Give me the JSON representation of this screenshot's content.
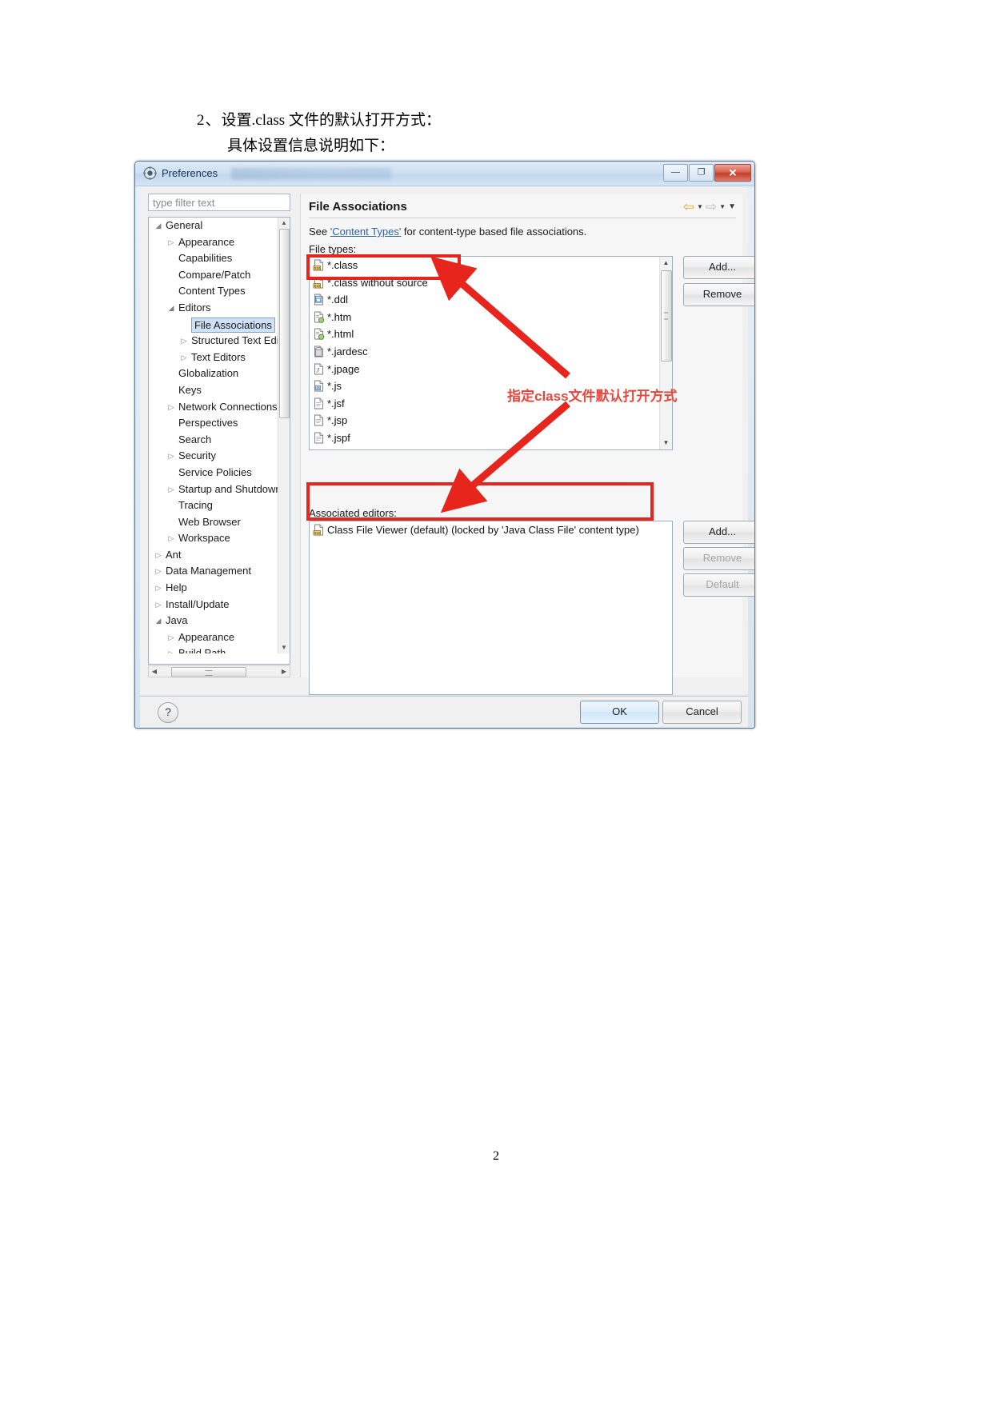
{
  "document": {
    "heading_number": "2、",
    "heading_text": "设置.class 文件的默认打开方式：",
    "sub_text": "具体设置信息说明如下：",
    "page_number": "2"
  },
  "window": {
    "title": "Preferences",
    "icon": "preferences-icon",
    "minimize_label": "—",
    "maximize_label": "❐",
    "close_label": "✕"
  },
  "sidebar": {
    "filter_placeholder": "type filter text",
    "items": [
      {
        "label": "General",
        "indent": 0,
        "arrow": "expanded",
        "selected": false
      },
      {
        "label": "Appearance",
        "indent": 1,
        "arrow": "collapsed",
        "selected": false
      },
      {
        "label": "Capabilities",
        "indent": 1,
        "arrow": "none",
        "selected": false
      },
      {
        "label": "Compare/Patch",
        "indent": 1,
        "arrow": "none",
        "selected": false
      },
      {
        "label": "Content Types",
        "indent": 1,
        "arrow": "none",
        "selected": false
      },
      {
        "label": "Editors",
        "indent": 1,
        "arrow": "expanded",
        "selected": false
      },
      {
        "label": "File Associations",
        "indent": 2,
        "arrow": "none",
        "selected": true
      },
      {
        "label": "Structured Text Editors",
        "indent": 2,
        "arrow": "collapsed",
        "selected": false
      },
      {
        "label": "Text Editors",
        "indent": 2,
        "arrow": "collapsed",
        "selected": false
      },
      {
        "label": "Globalization",
        "indent": 1,
        "arrow": "none",
        "selected": false
      },
      {
        "label": "Keys",
        "indent": 1,
        "arrow": "none",
        "selected": false
      },
      {
        "label": "Network Connections",
        "indent": 1,
        "arrow": "collapsed",
        "selected": false
      },
      {
        "label": "Perspectives",
        "indent": 1,
        "arrow": "none",
        "selected": false
      },
      {
        "label": "Search",
        "indent": 1,
        "arrow": "none",
        "selected": false
      },
      {
        "label": "Security",
        "indent": 1,
        "arrow": "collapsed",
        "selected": false
      },
      {
        "label": "Service Policies",
        "indent": 1,
        "arrow": "none",
        "selected": false
      },
      {
        "label": "Startup and Shutdown",
        "indent": 1,
        "arrow": "collapsed",
        "selected": false
      },
      {
        "label": "Tracing",
        "indent": 1,
        "arrow": "none",
        "selected": false
      },
      {
        "label": "Web Browser",
        "indent": 1,
        "arrow": "none",
        "selected": false
      },
      {
        "label": "Workspace",
        "indent": 1,
        "arrow": "collapsed",
        "selected": false
      },
      {
        "label": "Ant",
        "indent": 0,
        "arrow": "collapsed",
        "selected": false
      },
      {
        "label": "Data Management",
        "indent": 0,
        "arrow": "collapsed",
        "selected": false
      },
      {
        "label": "Help",
        "indent": 0,
        "arrow": "collapsed",
        "selected": false
      },
      {
        "label": "Install/Update",
        "indent": 0,
        "arrow": "collapsed",
        "selected": false
      },
      {
        "label": "Java",
        "indent": 0,
        "arrow": "expanded",
        "selected": false
      },
      {
        "label": "Appearance",
        "indent": 1,
        "arrow": "collapsed",
        "selected": false
      },
      {
        "label": "Build Path",
        "indent": 1,
        "arrow": "collapsed",
        "selected": false
      }
    ]
  },
  "content": {
    "page_title": "File Associations",
    "see_prefix": "See ",
    "see_link": "'Content Types'",
    "see_suffix": " for content-type based file associations.",
    "file_types_label": "File types:",
    "associated_editors_label": "Associated editors:",
    "file_types": [
      {
        "label": "*.class",
        "icon": "class-file-icon"
      },
      {
        "label": "*.class without source",
        "icon": "class-file-icon"
      },
      {
        "label": "*.ddl",
        "icon": "ddl-file-icon"
      },
      {
        "label": "*.htm",
        "icon": "html-file-icon"
      },
      {
        "label": "*.html",
        "icon": "html-file-icon"
      },
      {
        "label": "*.jardesc",
        "icon": "jar-file-icon"
      },
      {
        "label": "*.jpage",
        "icon": "jpage-file-icon"
      },
      {
        "label": "*.js",
        "icon": "js-file-icon"
      },
      {
        "label": "*.jsf",
        "icon": "generic-file-icon"
      },
      {
        "label": "*.jsp",
        "icon": "generic-file-icon"
      },
      {
        "label": "*.jspf",
        "icon": "generic-file-icon"
      }
    ],
    "associated_editors": [
      {
        "label": "Class File Viewer (default) (locked by 'Java Class File' content type)",
        "icon": "class-file-icon"
      }
    ],
    "buttons": {
      "add_file_type": "Add...",
      "remove_file_type": "Remove",
      "add_editor": "Add...",
      "remove_editor": "Remove",
      "default_editor": "Default"
    }
  },
  "footer": {
    "help_label": "?",
    "ok_label": "OK",
    "cancel_label": "Cancel"
  },
  "annotation": {
    "note_text": "指定class文件默认打开方式",
    "highlight_color": "#e8251c",
    "note_color": "#e8463c"
  }
}
